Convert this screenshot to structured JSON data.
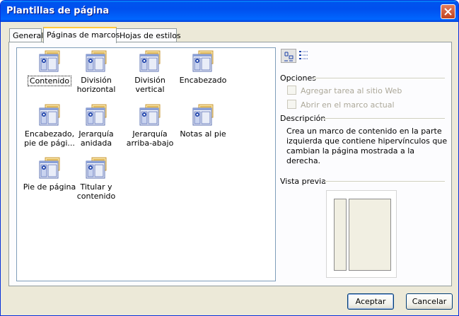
{
  "window": {
    "title": "Plantillas de página"
  },
  "tabs": [
    {
      "label": "General"
    },
    {
      "label": "Páginas de marcos"
    },
    {
      "label": "Hojas de estilos"
    }
  ],
  "templates": [
    {
      "lines": [
        "Contenido"
      ]
    },
    {
      "lines": [
        "División",
        "horizontal"
      ]
    },
    {
      "lines": [
        "División",
        "vertical"
      ]
    },
    {
      "lines": [
        "Encabezado"
      ]
    },
    {
      "lines": [
        "Encabezado,",
        "pie de pági..."
      ]
    },
    {
      "lines": [
        "Jerarquía",
        "anidada"
      ]
    },
    {
      "lines": [
        "Jerarquía",
        "arriba-abajo"
      ]
    },
    {
      "lines": [
        "Notas al pie"
      ]
    },
    {
      "lines": [
        "Pie de página"
      ]
    },
    {
      "lines": [
        "Titular y",
        "contenido"
      ]
    }
  ],
  "options": {
    "title": "Opciones",
    "add_task": "Agregar tarea al sitio Web",
    "open_in_frame": "Abrir en el marco actual"
  },
  "description": {
    "title": "Descripción",
    "text": "Crea un marco de contenido en la parte izquierda que contiene hipervínculos que cambian la página mostrada a la derecha."
  },
  "preview": {
    "title": "Vista previa"
  },
  "buttons": {
    "ok": "Aceptar",
    "cancel": "Cancelar"
  }
}
